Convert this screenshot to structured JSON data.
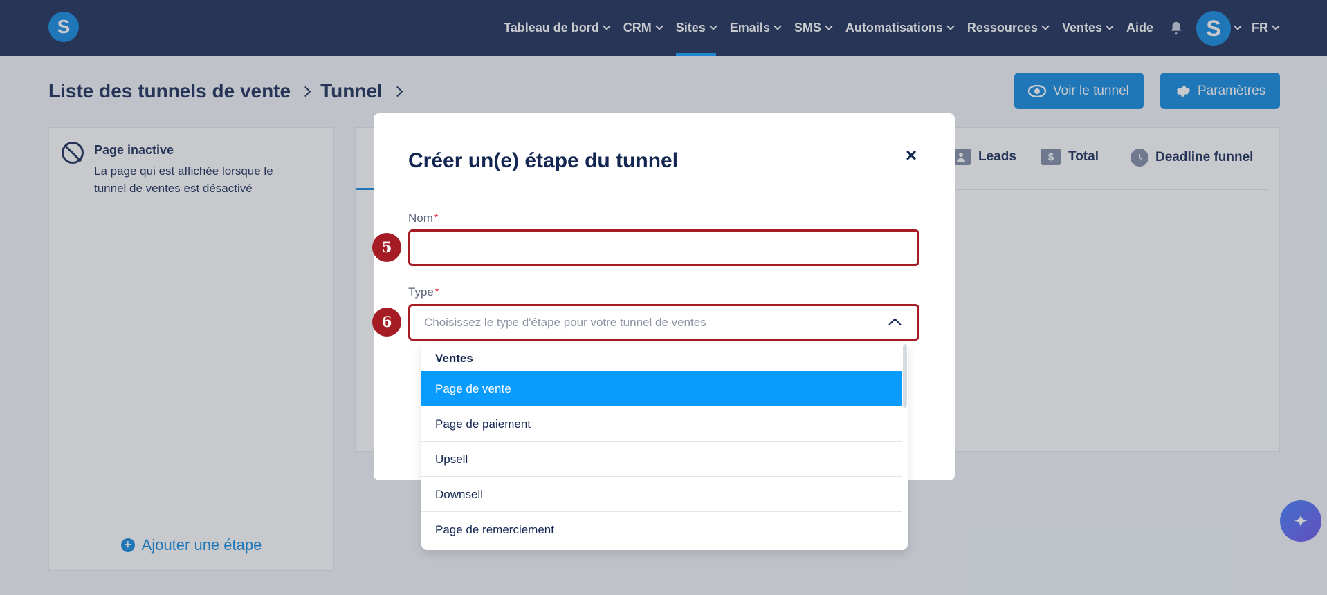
{
  "nav": {
    "logo_letter": "S",
    "items": [
      {
        "label": "Tableau de bord",
        "dropdown": true
      },
      {
        "label": "CRM",
        "dropdown": true
      },
      {
        "label": "Sites",
        "dropdown": true,
        "active": true
      },
      {
        "label": "Emails",
        "dropdown": true
      },
      {
        "label": "SMS",
        "dropdown": true
      },
      {
        "label": "Automatisations",
        "dropdown": true
      },
      {
        "label": "Ressources",
        "dropdown": true
      },
      {
        "label": "Ventes",
        "dropdown": true
      },
      {
        "label": "Aide",
        "dropdown": false
      }
    ],
    "avatar_letter": "S",
    "language": "FR"
  },
  "breadcrumb": {
    "item1": "Liste des tunnels de vente",
    "item2": "Tunnel"
  },
  "header_buttons": {
    "view_label": "Voir le tunnel",
    "settings_label": "Paramètres"
  },
  "left_panel": {
    "title": "Page inactive",
    "description": "La page qui est affichée lorsque le tunnel de ventes est désactivé",
    "add_step_label": "Ajouter une étape"
  },
  "tabs": {
    "leads": "Leads",
    "total": "Total",
    "deadline": "Deadline funnel",
    "total_icon_text": "$"
  },
  "modal": {
    "title": "Créer un(e) étape du tunnel",
    "close_symbol": "×",
    "name_label": "Nom",
    "name_value": "",
    "type_label": "Type",
    "required_mark": "*",
    "type_placeholder": "Choisissez le type d'étape pour votre tunnel de ventes"
  },
  "annotations": {
    "name_step": "5",
    "type_step": "6"
  },
  "dropdown": {
    "group_label": "Ventes",
    "options": [
      "Page de vente",
      "Page de paiement",
      "Upsell",
      "Downsell",
      "Page de remerciement"
    ],
    "selected_index": 0
  },
  "colors": {
    "nav_bg": "#142552",
    "accent": "#0a87e0",
    "highlight": "#0a9bff",
    "annotation_red": "#a51c24"
  }
}
